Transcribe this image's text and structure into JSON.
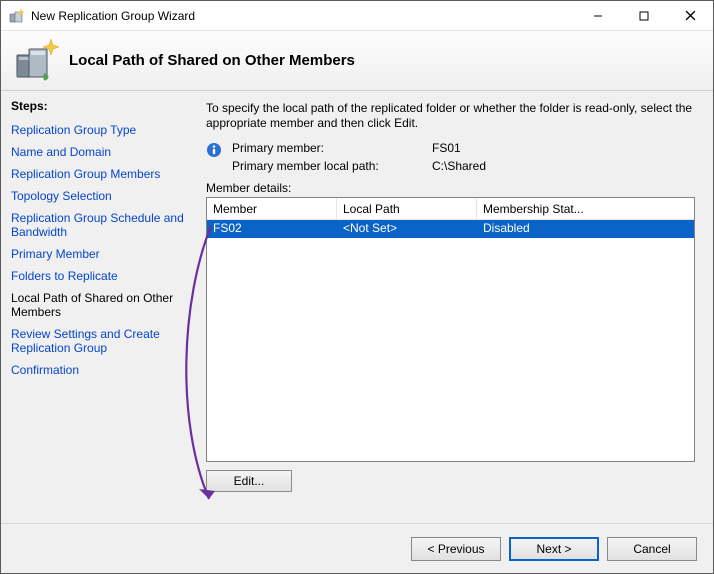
{
  "window": {
    "title": "New Replication Group Wizard"
  },
  "header": {
    "title": "Local Path of Shared on Other Members"
  },
  "sidebar": {
    "title": "Steps:",
    "items": [
      {
        "label": "Replication Group Type"
      },
      {
        "label": "Name and Domain"
      },
      {
        "label": "Replication Group Members"
      },
      {
        "label": "Topology Selection"
      },
      {
        "label": "Replication Group Schedule and Bandwidth"
      },
      {
        "label": "Primary Member"
      },
      {
        "label": "Folders to Replicate"
      },
      {
        "label": "Local Path of Shared on Other Members"
      },
      {
        "label": "Review Settings and Create Replication Group"
      },
      {
        "label": "Confirmation"
      }
    ],
    "current_index": 7
  },
  "content": {
    "instruction": "To specify the local path of the replicated folder or whether the folder is read-only, select the appropriate member and then click Edit.",
    "primary_member_label": "Primary member:",
    "primary_member_value": "FS01",
    "primary_path_label": "Primary member local path:",
    "primary_path_value": "C:\\Shared",
    "member_details_label": "Member details:",
    "columns": {
      "member": "Member",
      "local_path": "Local Path",
      "status": "Membership Stat..."
    },
    "rows": [
      {
        "member": "FS02",
        "local_path": "<Not Set>",
        "status": "Disabled",
        "selected": true
      }
    ],
    "edit_label": "Edit..."
  },
  "footer": {
    "previous": "< Previous",
    "next": "Next >",
    "cancel": "Cancel"
  }
}
